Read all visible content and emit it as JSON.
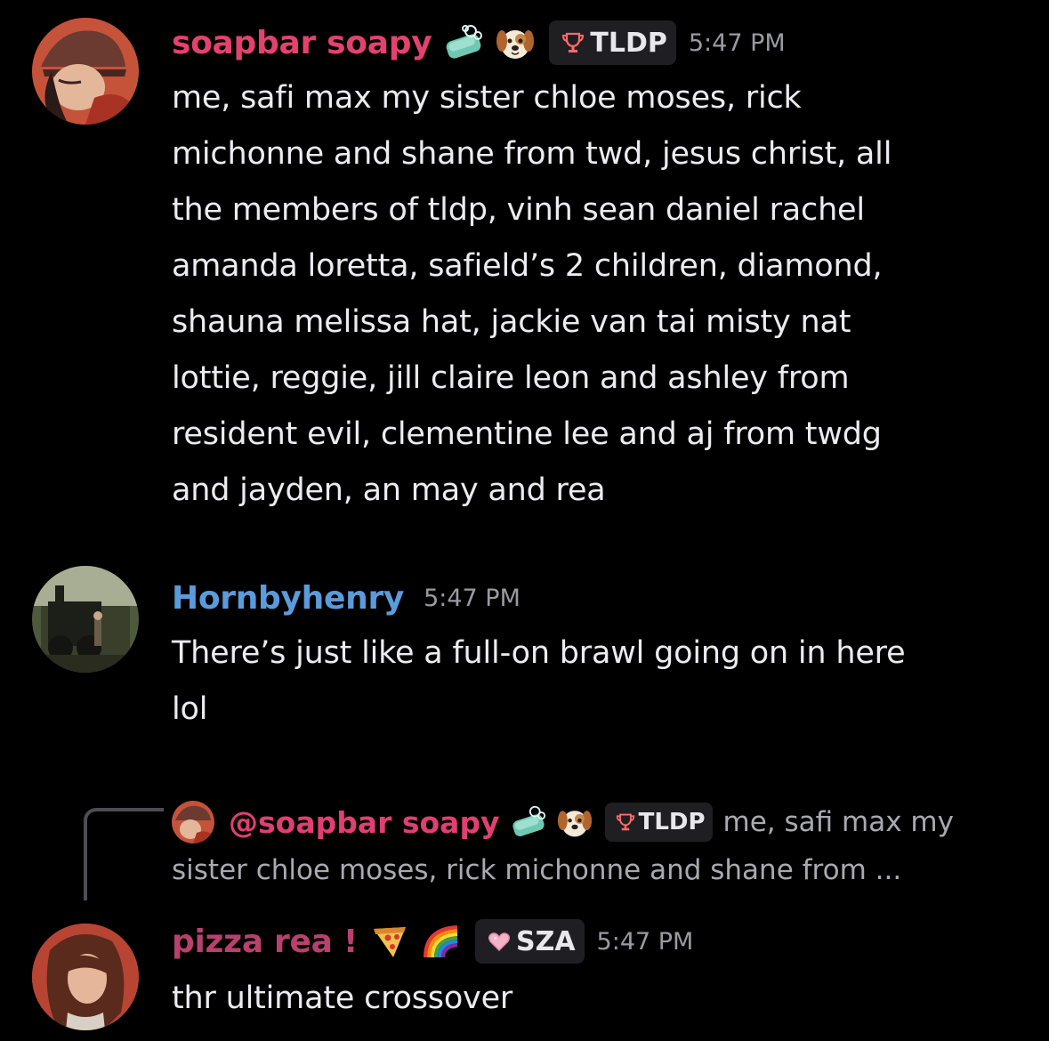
{
  "messages": [
    {
      "username": "soapbar soapy",
      "username_color": "#e5416f",
      "emojis": [
        "soap-emoji",
        "dog-face-emoji"
      ],
      "tag": {
        "icon": "trophy-icon",
        "label": "TLDP"
      },
      "time": "5:47 PM",
      "text": "me, safi max my sister chloe moses, rick\nmichonne and shane from twd, jesus christ, all\nthe members of tldp, vinh sean daniel rachel\namanda loretta, safield’s 2 children, diamond,\nshauna melissa hat, jackie van tai misty nat\nlottie, reggie, jill claire leon and ashley from\nresident evil, clementine lee and aj from twdg\nand jayden, an may and rea"
    },
    {
      "username": "Hornbyhenry",
      "username_color": "#5a9bdc",
      "time": "5:47 PM",
      "text": "There’s just like a full-on brawl going on in here\nlol"
    },
    {
      "reply": {
        "username": "@soapbar soapy",
        "emojis": [
          "soap-emoji",
          "dog-face-emoji"
        ],
        "tag": {
          "icon": "trophy-icon",
          "label": "TLDP"
        },
        "snippet_line1": "me, safi max my",
        "snippet_line2": "sister chloe moses, rick michonne and shane from ..."
      },
      "username": "pizza rea !",
      "username_color": "#b8416e",
      "emojis": [
        "pizza-emoji",
        "rainbow-emoji"
      ],
      "tag": {
        "icon": "pink-heart-icon",
        "label": "SZA"
      },
      "time": "5:47 PM",
      "text": "thr ultimate crossover"
    }
  ]
}
